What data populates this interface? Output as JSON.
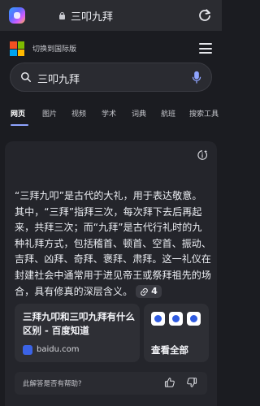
{
  "browser": {
    "url": "三叩九拜"
  },
  "header": {
    "intl_link": "切换到国际版"
  },
  "search": {
    "query": "三叩九拜"
  },
  "tabs": [
    {
      "label": "网页",
      "active": true
    },
    {
      "label": "图片"
    },
    {
      "label": "视频"
    },
    {
      "label": "学术"
    },
    {
      "label": "词典"
    },
    {
      "label": "航班"
    },
    {
      "label": "搜索工具"
    }
  ],
  "answer": {
    "text": "“三拜九叩”是古代的大礼，用于表达敬意。其中，“三拜”指拜三次，每次拜下去后再起来，共拜三次；而“九拜”是古代行礼时的九种礼拜方式，包括稽首、顿首、空首、振动、吉拜、凶拜、奇拜、褒拜、肃拜。这一礼仪在封建社会中通常用于进见帝王或祭拜祖先的场合，具有修真的深层含义。",
    "citation_count": "4"
  },
  "source": {
    "title": "三拜九叩和三叩九拜有什么区别 - 百度知道",
    "domain": "baidu.com"
  },
  "view_all": {
    "label": "查看全部"
  },
  "feedback": {
    "question": "此解答是否有帮助?"
  },
  "colors": {
    "background": "#1b1c21",
    "card": "#24252b",
    "accent": "#8fa4ff"
  }
}
